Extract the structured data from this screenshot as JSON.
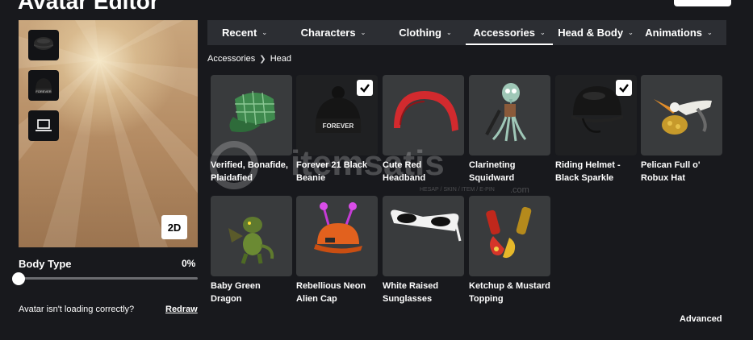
{
  "page": {
    "title": "Avatar Editor"
  },
  "avatar_preview": {
    "slots": [
      {
        "icon": "helmet-icon"
      },
      {
        "icon": "beanie-icon",
        "text": "FOREVER"
      },
      {
        "icon": "laptop-icon"
      }
    ],
    "view_toggle_label": "2D"
  },
  "body_type": {
    "label": "Body Type",
    "value_text": "0%",
    "value": 0
  },
  "loading_help": {
    "text": "Avatar isn't loading correctly?",
    "link": "Redraw"
  },
  "tabs": [
    {
      "label": "Recent",
      "active": false
    },
    {
      "label": "Characters",
      "active": false
    },
    {
      "label": "Clothing",
      "active": false
    },
    {
      "label": "Accessories",
      "active": true
    },
    {
      "label": "Head & Body",
      "active": false
    },
    {
      "label": "Animations",
      "active": false
    }
  ],
  "breadcrumb": {
    "parent": "Accessories",
    "current": "Head"
  },
  "items": [
    {
      "name": "Verified, Bonafide, Plaidafied",
      "selected": false,
      "icon": "plaid-cap-icon"
    },
    {
      "name": "Forever 21 Black Beanie",
      "selected": true,
      "icon": "beanie-icon",
      "print": "FOREVER"
    },
    {
      "name": "Cute Red Headband",
      "selected": false,
      "icon": "headband-icon"
    },
    {
      "name": "Clarineting Squidward",
      "selected": false,
      "icon": "squidward-icon"
    },
    {
      "name": "Riding Helmet - Black Sparkle",
      "selected": true,
      "icon": "riding-helmet-icon"
    },
    {
      "name": "Pelican Full o' Robux Hat",
      "selected": false,
      "icon": "pelican-icon"
    },
    {
      "name": "Baby Green Dragon",
      "selected": false,
      "icon": "dragon-icon"
    },
    {
      "name": "Rebellious Neon Alien Cap",
      "selected": false,
      "icon": "alien-cap-icon"
    },
    {
      "name": "White Raised Sunglasses",
      "selected": false,
      "icon": "sunglasses-icon"
    },
    {
      "name": "Ketchup & Mustard Topping",
      "selected": false,
      "icon": "ketchup-mustard-icon"
    }
  ],
  "advanced_link": "Advanced",
  "watermark": {
    "brand": "itemsatis",
    "tagline": "HESAP / SKIN / ITEM / E-PIN",
    "domain": ".com"
  },
  "colors": {
    "background": "#18191d",
    "card": "#393b3d",
    "tab_bar": "#2c2e33"
  }
}
